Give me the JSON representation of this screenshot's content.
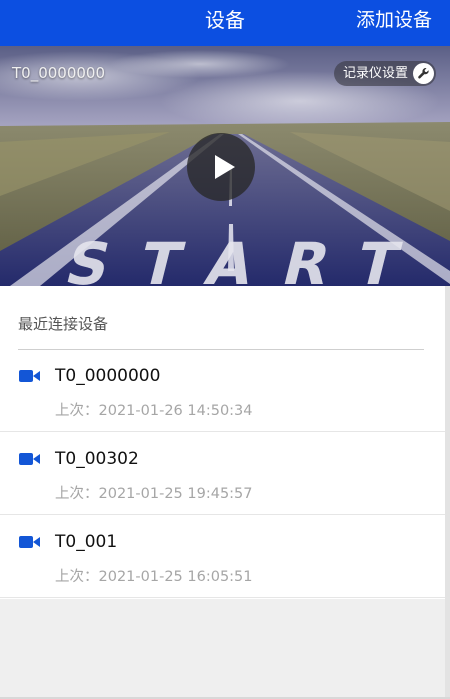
{
  "topbar": {
    "title": "设备",
    "add_label": "添加设备"
  },
  "hero": {
    "device_id": "T0_0000000",
    "recorder_settings_label": "记录仪设置",
    "road_text": "START"
  },
  "recent": {
    "heading": "最近连接设备",
    "last_prefix": "上次：",
    "devices": [
      {
        "name": "T0_0000000",
        "last_time": "2021-01-26 14:50:34"
      },
      {
        "name": "T0_00302",
        "last_time": "2021-01-25 19:45:57"
      },
      {
        "name": "T0_001",
        "last_time": "2021-01-25 16:05:51"
      }
    ]
  },
  "colors": {
    "brand_blue": "#0c4fe1",
    "camera_icon": "#1356d6"
  },
  "icons": [
    "wrench-icon",
    "play-icon",
    "video-camera-icon"
  ]
}
